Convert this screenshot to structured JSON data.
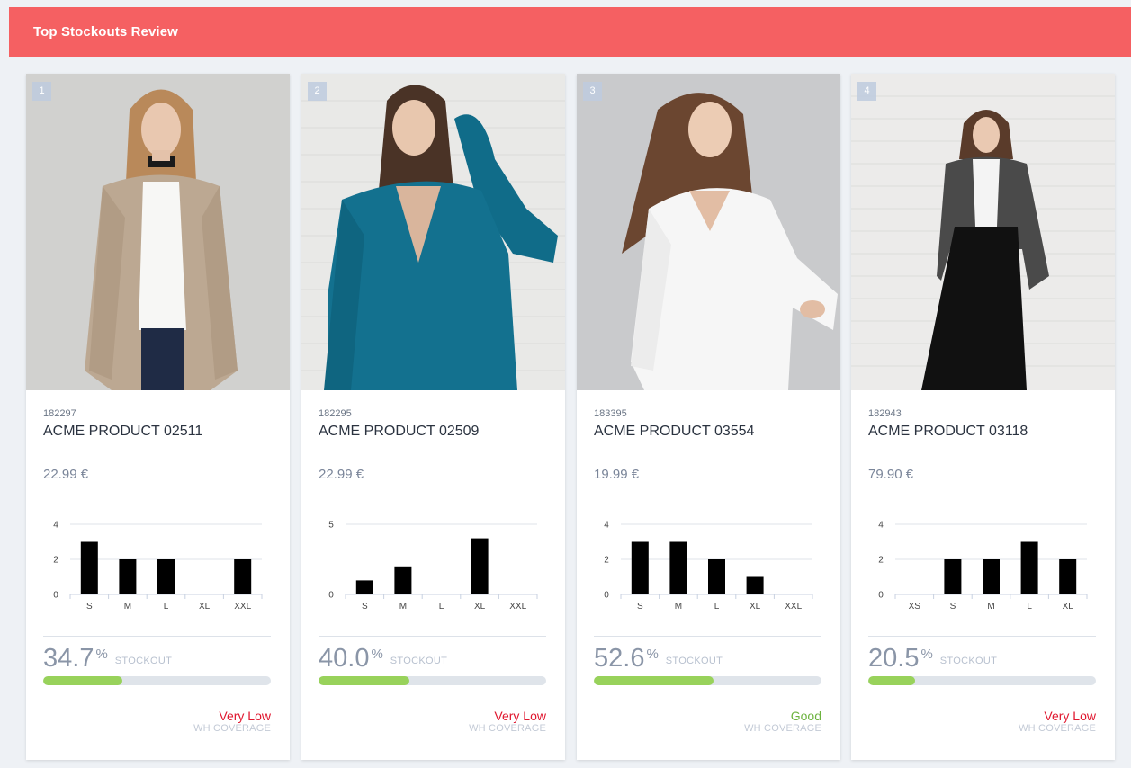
{
  "header": {
    "title": "Top Stockouts Review"
  },
  "colors": {
    "header_bg": "#f56062",
    "bar": "#000000",
    "progress_fill": "#98d25b",
    "progress_track": "#dfe4ea",
    "status_bad": "#e0172f",
    "status_good": "#6db33f"
  },
  "cards": [
    {
      "rank": "1",
      "sku": "182297",
      "name": "ACME PRODUCT 02511",
      "price": "22.99 €",
      "stockout_value": "34.7",
      "stockout_unit": "%",
      "stockout_label": "STOCKOUT",
      "stockout_fraction": 0.347,
      "coverage_status": "Very Low",
      "coverage_status_color": "#e0172f",
      "coverage_label": "WH COVERAGE",
      "image_subject": "woman in beige cardigan with white top and jeans",
      "chart_data": {
        "type": "bar",
        "categories": [
          "S",
          "M",
          "L",
          "XL",
          "XXL"
        ],
        "values": [
          3,
          2,
          2,
          0,
          2
        ],
        "yticks": [
          0,
          2,
          4
        ],
        "ylim": [
          0,
          4
        ],
        "grid": true
      }
    },
    {
      "rank": "2",
      "sku": "182295",
      "name": "ACME PRODUCT 02509",
      "price": "22.99 €",
      "stockout_value": "40.0",
      "stockout_unit": "%",
      "stockout_label": "STOCKOUT",
      "stockout_fraction": 0.4,
      "coverage_status": "Very Low",
      "coverage_status_color": "#e0172f",
      "coverage_label": "WH COVERAGE",
      "image_subject": "woman in teal knit cardigan against white brick wall",
      "chart_data": {
        "type": "bar",
        "categories": [
          "S",
          "M",
          "L",
          "XL",
          "XXL"
        ],
        "values": [
          1,
          2,
          0,
          4,
          0
        ],
        "yticks": [
          0,
          5
        ],
        "ylim": [
          0,
          5
        ],
        "grid": true
      }
    },
    {
      "rank": "3",
      "sku": "183395",
      "name": "ACME PRODUCT 03554",
      "price": "19.99 €",
      "stockout_value": "52.6",
      "stockout_unit": "%",
      "stockout_label": "STOCKOUT",
      "stockout_fraction": 0.526,
      "coverage_status": "Good",
      "coverage_status_color": "#6db33f",
      "coverage_label": "WH COVERAGE",
      "image_subject": "woman in white v-neck blouse on grey background",
      "chart_data": {
        "type": "bar",
        "categories": [
          "S",
          "M",
          "L",
          "XL",
          "XXL"
        ],
        "values": [
          3,
          3,
          2,
          1,
          0
        ],
        "yticks": [
          0,
          2,
          4
        ],
        "ylim": [
          0,
          4
        ],
        "grid": true
      }
    },
    {
      "rank": "4",
      "sku": "182943",
      "name": "ACME PRODUCT 03118",
      "price": "79.90 €",
      "stockout_value": "20.5",
      "stockout_unit": "%",
      "stockout_label": "STOCKOUT",
      "stockout_fraction": 0.205,
      "coverage_status": "Very Low",
      "coverage_status_color": "#e0172f",
      "coverage_label": "WH COVERAGE",
      "image_subject": "woman in grey blazer, white shirt and black wide trousers",
      "chart_data": {
        "type": "bar",
        "categories": [
          "XS",
          "S",
          "M",
          "L",
          "XL"
        ],
        "values": [
          0,
          2,
          2,
          3,
          2
        ],
        "yticks": [
          0,
          2,
          4
        ],
        "ylim": [
          0,
          4
        ],
        "grid": true
      }
    }
  ]
}
